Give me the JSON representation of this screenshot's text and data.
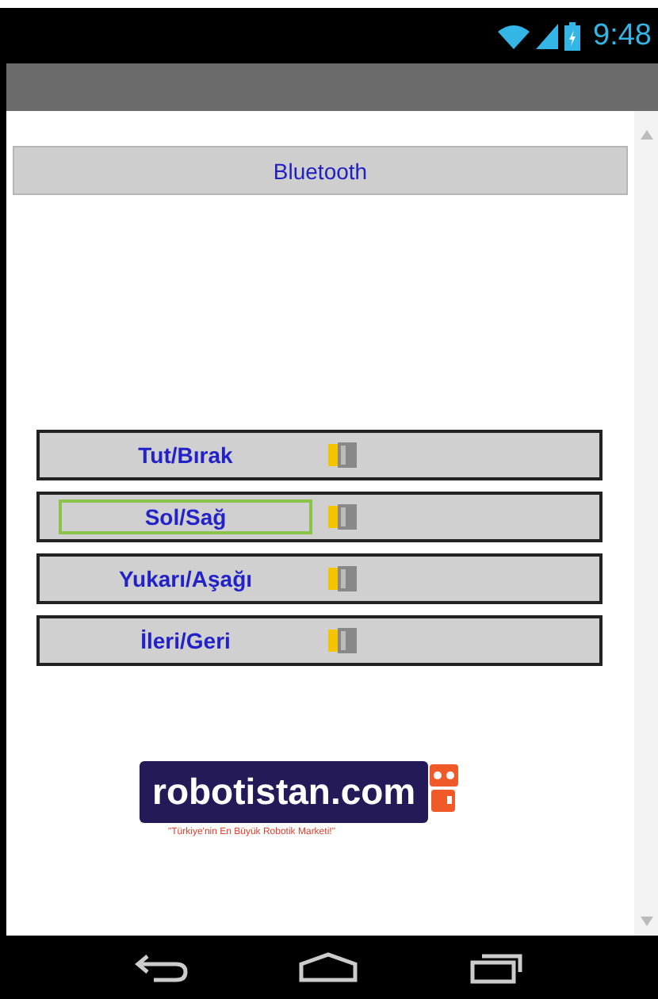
{
  "status_bar": {
    "time": "9:48"
  },
  "bluetooth_button": {
    "label": "Bluetooth"
  },
  "controls": [
    {
      "label": "Tut/Bırak",
      "focused": false
    },
    {
      "label": "Sol/Sağ",
      "focused": true
    },
    {
      "label": "Yukarı/Aşağı",
      "focused": false
    },
    {
      "label": "İleri/Geri",
      "focused": false
    }
  ],
  "logo": {
    "name": "robotistan.com",
    "tagline": "\"Türkiye'nin En Büyük Robotik Marketi!\""
  }
}
